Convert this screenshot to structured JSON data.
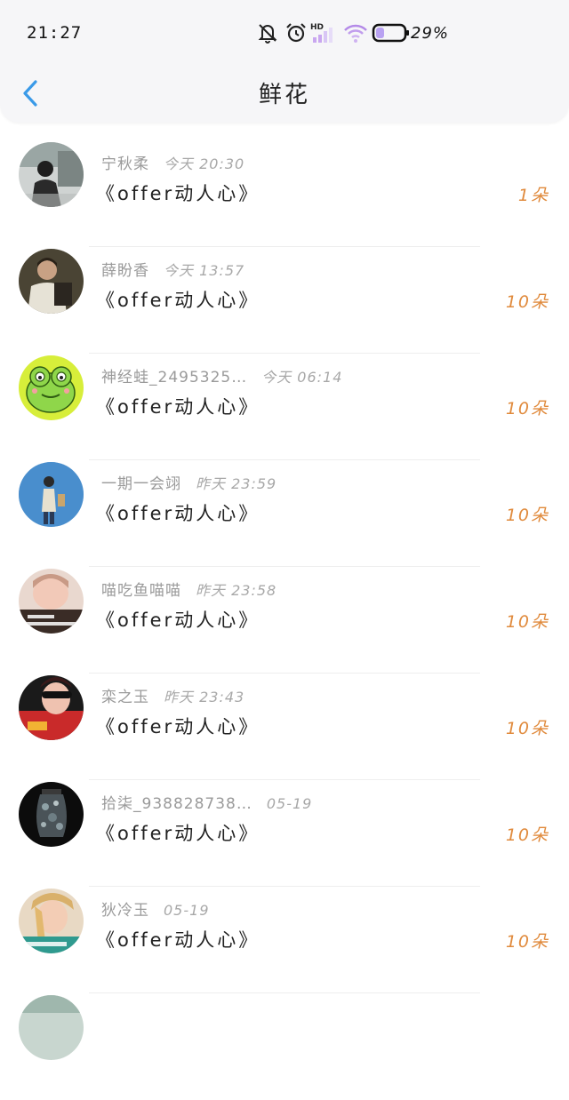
{
  "status_bar": {
    "time": "21:27",
    "battery_percent": "29%",
    "signal_label": "HD",
    "icons": [
      "bell-muted-icon",
      "alarm-icon",
      "signal-icon",
      "wifi-icon",
      "battery-icon"
    ]
  },
  "header": {
    "title": "鲜花",
    "back_icon": "chevron-left-icon",
    "accent_color": "#3a9ae8"
  },
  "colors": {
    "amount": "#e08a3c",
    "name": "#9a9a9a"
  },
  "gifts": [
    {
      "name": "宁秋柔",
      "time": "今天 20:30",
      "work": "《offer动人心》",
      "amount": "1朵"
    },
    {
      "name": "薛盼香",
      "time": "今天 13:57",
      "work": "《offer动人心》",
      "amount": "10朵"
    },
    {
      "name": "神经蛙_2495325…",
      "time": "今天 06:14",
      "work": "《offer动人心》",
      "amount": "10朵"
    },
    {
      "name": "一期一会翊",
      "time": "昨天 23:59",
      "work": "《offer动人心》",
      "amount": "10朵"
    },
    {
      "name": "喵吃鱼喵喵",
      "time": "昨天 23:58",
      "work": "《offer动人心》",
      "amount": "10朵"
    },
    {
      "name": "栾之玉",
      "time": "昨天 23:43",
      "work": "《offer动人心》",
      "amount": "10朵"
    },
    {
      "name": "拾柒_938828738…",
      "time": "05-19",
      "work": "《offer动人心》",
      "amount": "10朵"
    },
    {
      "name": "狄冷玉",
      "time": "05-19",
      "work": "《offer动人心》",
      "amount": "10朵"
    }
  ]
}
